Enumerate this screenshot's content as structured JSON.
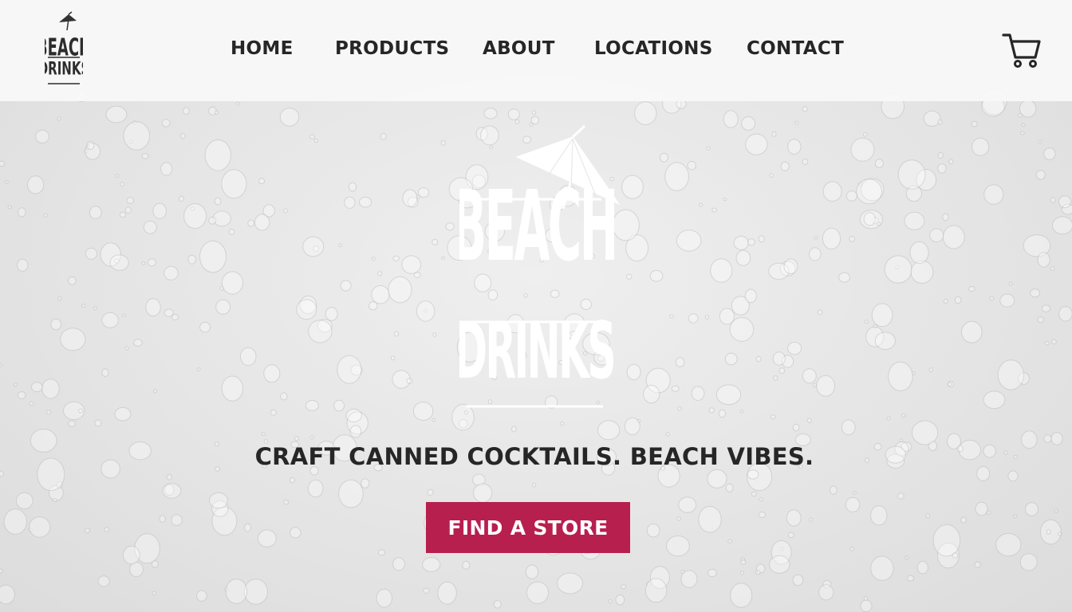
{
  "brand": {
    "logo_line1": "BEACH",
    "logo_line2": "DRINKS",
    "logo_icon": "cocktail-umbrella-icon"
  },
  "nav": {
    "items": [
      {
        "label": "HOME"
      },
      {
        "label": "PRODUCTS"
      },
      {
        "label": "ABOUT"
      },
      {
        "label": "LOCATIONS"
      },
      {
        "label": "CONTACT"
      }
    ],
    "cart_icon": "shopping-cart-icon"
  },
  "hero": {
    "tagline": "CRAFT CANNED COCKTAILS. BEACH VIBES.",
    "cta_label": "FIND A STORE",
    "background": "water-droplets"
  },
  "colors": {
    "accent": "#b71f4e",
    "text": "#262626",
    "header_bg": "#f8f8f8"
  }
}
